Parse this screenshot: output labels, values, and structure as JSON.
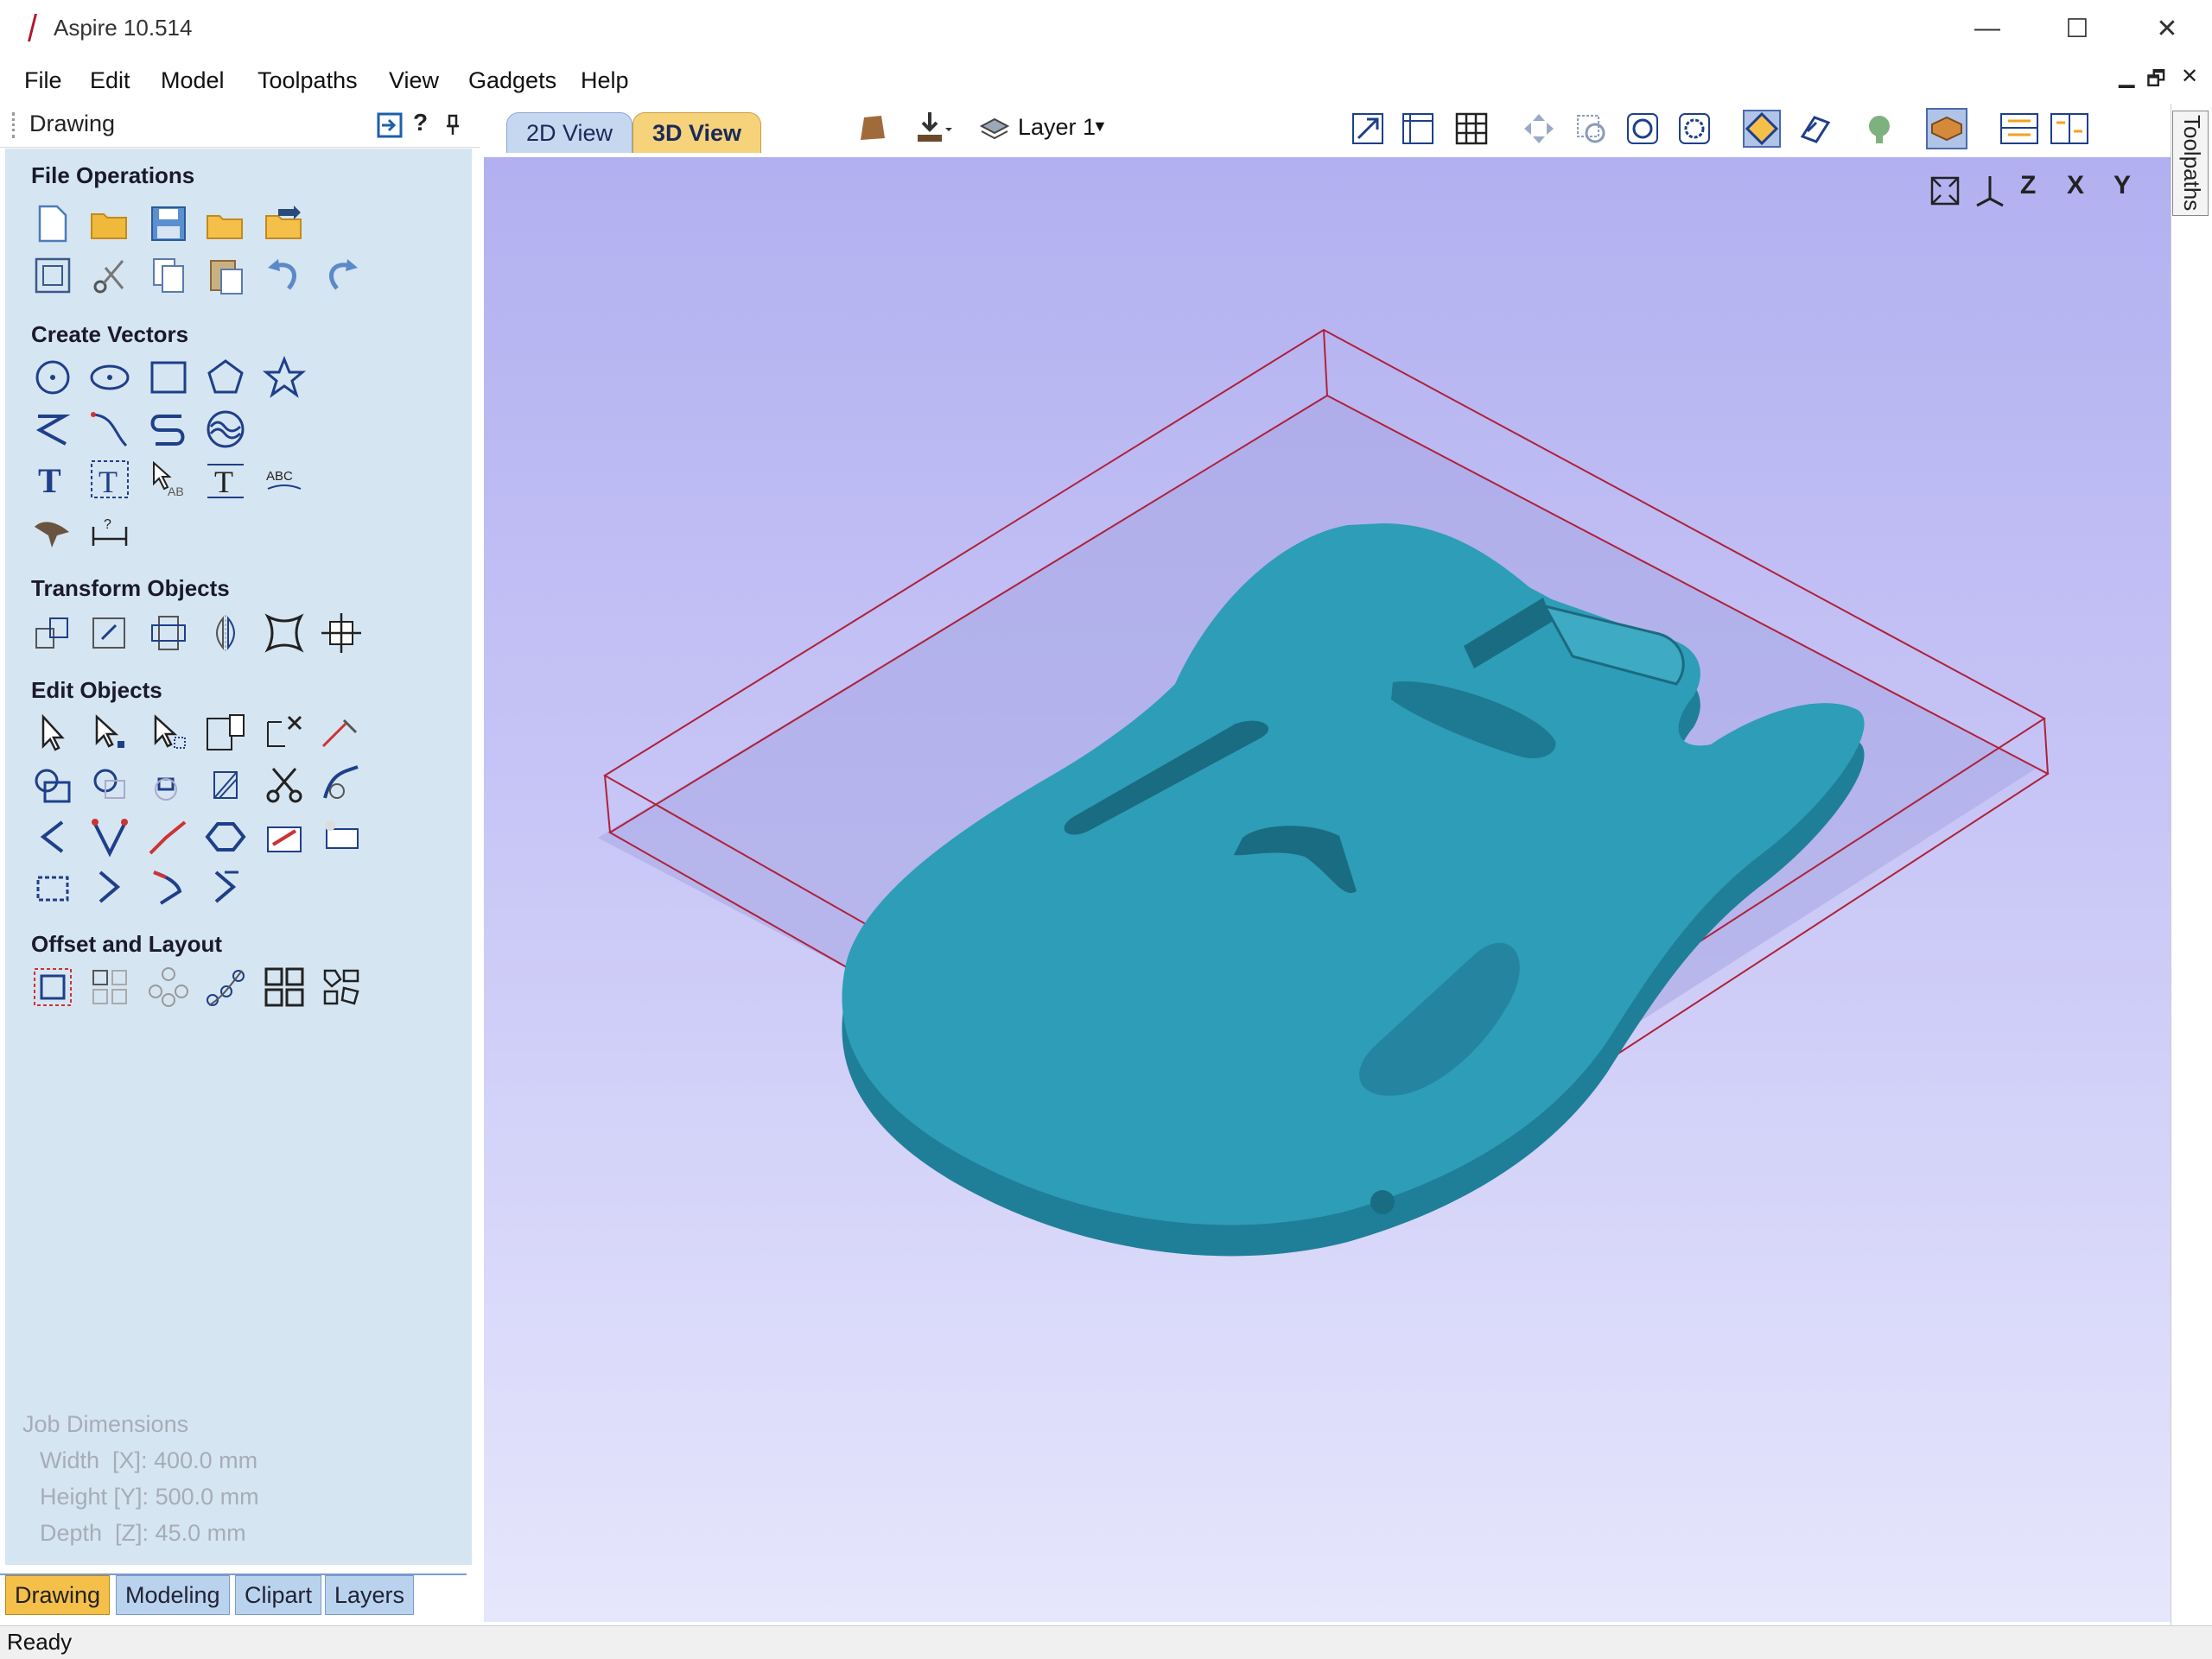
{
  "window": {
    "title": "Aspire 10.514",
    "minimize": "—",
    "maximize": "☐",
    "close": "✕"
  },
  "menu": [
    "File",
    "Edit",
    "Model",
    "Toolpaths",
    "View",
    "Gadgets",
    "Help"
  ],
  "mdi_controls": {
    "minimize": "▁",
    "restore": "🗗",
    "close": "✕"
  },
  "panel": {
    "title": "Drawing",
    "header_help": "?",
    "sections": {
      "file_operations": "File Operations",
      "create_vectors": "Create Vectors",
      "transform_objects": "Transform Objects",
      "edit_objects": "Edit Objects",
      "offset_layout": "Offset and Layout"
    },
    "job_dimensions": {
      "heading": "Job Dimensions",
      "width": "Width  [X]: 400.0 mm",
      "height": "Height [Y]: 500.0 mm",
      "depth": "Depth  [Z]: 45.0 mm"
    },
    "bottom_tabs": [
      "Drawing",
      "Modeling",
      "Clipart",
      "Layers"
    ]
  },
  "view_tabs": [
    "2D View",
    "3D View"
  ],
  "layer_selector": "Layer 1",
  "right_tab": "Toolpaths",
  "axis_buttons": [
    "Z",
    "X",
    "Y"
  ],
  "status": "Ready",
  "colors": {
    "body": "#2e9db7",
    "viewport_top": "#b2b0f0",
    "panel": "#d6e5f2",
    "box_edge": "#b0203a"
  }
}
